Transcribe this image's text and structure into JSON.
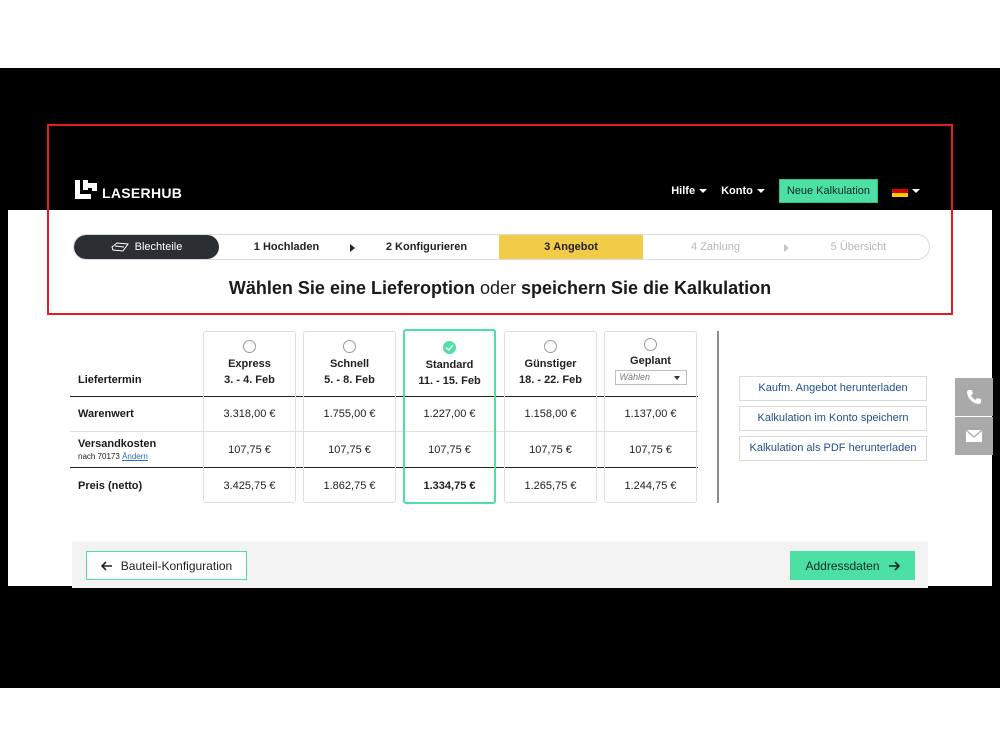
{
  "brand": {
    "logo_text": "LASERHUB"
  },
  "nav": {
    "help": "Hilfe",
    "account": "Konto",
    "new_calc": "Neue Kalkulation",
    "language_flag": "flag-de-icon"
  },
  "stepper": {
    "category": "Blechteile",
    "steps": [
      {
        "num": "1",
        "label": "Hochladen",
        "state": "done"
      },
      {
        "num": "2",
        "label": "Konfigurieren",
        "state": "done"
      },
      {
        "num": "3",
        "label": "Angebot",
        "state": "active"
      },
      {
        "num": "4",
        "label": "Zahlung",
        "state": "pending"
      },
      {
        "num": "5",
        "label": "Übersicht",
        "state": "pending"
      }
    ]
  },
  "headline": {
    "part1": "Wählen Sie eine Lieferoption",
    "part2": " oder ",
    "part3": "speichern Sie die Kalkulation"
  },
  "table": {
    "row_labels": {
      "date": "Liefertermin",
      "goods": "Warenwert",
      "shipping": "Versandkosten",
      "shipping_sub": "nach 70173",
      "shipping_change": "Ändern",
      "price": "Preis (netto)"
    },
    "options": [
      {
        "name": "Express",
        "date": "3. - 4. Feb",
        "goods": "3.318,00 €",
        "shipping": "107,75 €",
        "price": "3.425,75 €"
      },
      {
        "name": "Schnell",
        "date": "5. - 8. Feb",
        "goods": "1.755,00 €",
        "shipping": "107,75 €",
        "price": "1.862,75 €"
      },
      {
        "name": "Standard",
        "date": "11. - 15. Feb",
        "goods": "1.227,00 €",
        "shipping": "107,75 €",
        "price": "1.334,75 €"
      },
      {
        "name": "Günstiger",
        "date": "18. - 22. Feb",
        "goods": "1.158,00 €",
        "shipping": "107,75 €",
        "price": "1.265,75 €"
      },
      {
        "name": "Geplant",
        "select_placeholder": "Wählen",
        "goods": "1.137,00 €",
        "shipping": "107,75 €",
        "price": "1.244,75 €"
      }
    ],
    "selected": "Standard"
  },
  "side_actions": {
    "download_offer": "Kaufm. Angebot herunterladen",
    "save_account": "Kalkulation im Konto speichern",
    "download_pdf": "Kalkulation als PDF herunterladen"
  },
  "footer": {
    "back": "Bauteil-Konfiguration",
    "next": "Addressdaten"
  },
  "colors": {
    "accent_green": "#4ce0a4",
    "active_step": "#f2cc47",
    "highlight_frame": "#e31b23"
  }
}
